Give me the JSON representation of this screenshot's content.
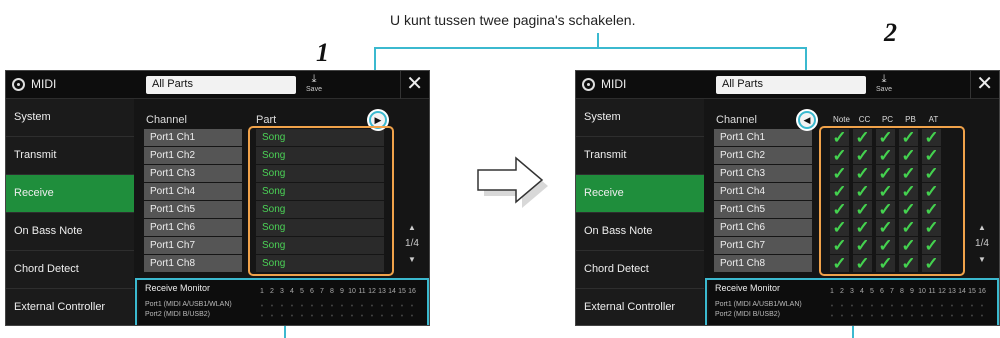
{
  "caption": "U kunt tussen twee pagina's schakelen.",
  "callouts": [
    "1",
    "2"
  ],
  "screen": {
    "title": "MIDI",
    "combo_value": "All Parts",
    "save_label": "Save",
    "close_glyph": "✕",
    "sidebar": [
      "System",
      "Transmit",
      "Receive",
      "On Bass Note",
      "Chord Detect",
      "External Controller"
    ],
    "active_index": 2,
    "col_channel": "Channel",
    "col_part": "Part",
    "check_headers": [
      "Note",
      "CC",
      "PC",
      "PB",
      "AT"
    ],
    "rows": [
      {
        "channel": "Port1 Ch1",
        "part": "Song"
      },
      {
        "channel": "Port1 Ch2",
        "part": "Song"
      },
      {
        "channel": "Port1 Ch3",
        "part": "Song"
      },
      {
        "channel": "Port1 Ch4",
        "part": "Song"
      },
      {
        "channel": "Port1 Ch5",
        "part": "Song"
      },
      {
        "channel": "Port1 Ch6",
        "part": "Song"
      },
      {
        "channel": "Port1 Ch7",
        "part": "Song"
      },
      {
        "channel": "Port1 Ch8",
        "part": "Song"
      }
    ],
    "check_glyph": "✓",
    "page_indicator": "1/4",
    "page_next_glyph": "▶",
    "page_prev_glyph": "◀",
    "page_up_glyph": "▲",
    "page_down_glyph": "▼",
    "monitor": {
      "title": "Receive Monitor",
      "port1": "Port1 (MIDI A/USB1/WLAN)",
      "port2": "Port2 (MIDI B/USB2)",
      "channels": [
        "1",
        "2",
        "3",
        "4",
        "5",
        "6",
        "7",
        "8",
        "9",
        "10",
        "11",
        "12",
        "13",
        "14",
        "15",
        "16"
      ]
    }
  },
  "colors": {
    "active_tab": "#1f8e3c",
    "song_text": "#4bd256",
    "check": "#44d24f",
    "orange_highlight": "#f0a24a",
    "cyan_highlight": "#3bb9cf"
  }
}
